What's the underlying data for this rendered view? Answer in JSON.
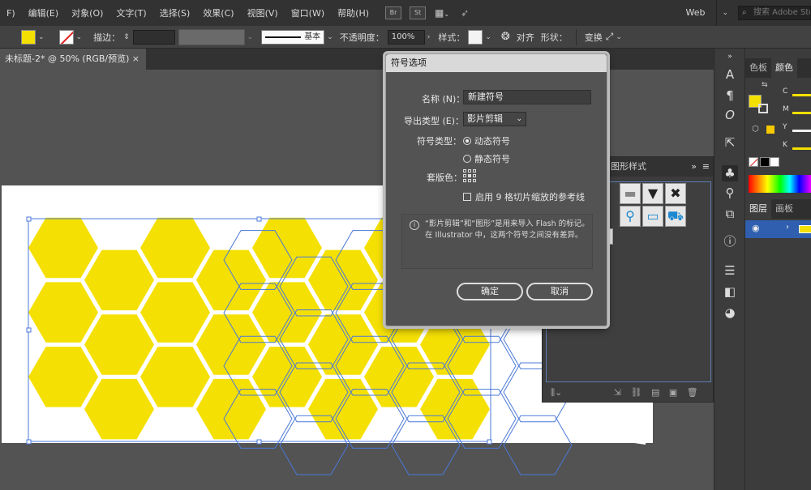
{
  "menubar": {
    "items": [
      "F)",
      "编辑(E)",
      "对象(O)",
      "文字(T)",
      "选择(S)",
      "效果(C)",
      "视图(V)",
      "窗口(W)",
      "帮助(H)"
    ],
    "br_label": "Br",
    "st_label": "St",
    "workspace": "Web",
    "search_placeholder": "搜索 Adobe Stock"
  },
  "controlbar": {
    "stroke_label": "描边：",
    "stroke_profile": "基本",
    "opacity_label": "不透明度：",
    "opacity_value": "100%",
    "style_label": "样式：",
    "align_label": "对齐",
    "shape_label": "形状：",
    "transform_label": "变换"
  },
  "document": {
    "tab_title": "未标题-2* @ 50% (RGB/预览)",
    "close": "×"
  },
  "right_panels": {
    "swatches_tab": "色板",
    "color_tab": "颜色",
    "layers_tab": "图层",
    "artboards_tab": "画板",
    "channels": [
      "C",
      "M",
      "Y",
      "K"
    ]
  },
  "symbols_panel": {
    "graphic_styles_tab": "图形样式"
  },
  "dialog": {
    "title": "符号选项",
    "name_label": "名称 (N)：",
    "name_value": "新建符号",
    "export_label": "导出类型 (E)：",
    "export_value": "影片剪辑",
    "symtype_label": "符号类型：",
    "dynamic_label": "动态符号",
    "static_label": "静态符号",
    "registration_label": "套版色：",
    "nine_slice_label": "启用 9 格切片缩放的参考线",
    "info_text": "“影片剪辑”和“图形”是用来导入 Flash 的标记。在 Illustrator 中，这两个符号之间没有差异。",
    "ok_label": "确定",
    "cancel_label": "取消"
  },
  "colors": {
    "accent_yellow": "#f5e003",
    "selection_blue": "#4a78d8",
    "ui_dark": "#323232",
    "ui_mid": "#535353"
  }
}
